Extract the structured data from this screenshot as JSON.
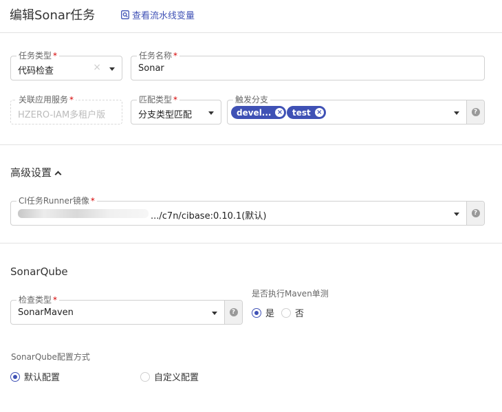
{
  "header": {
    "title": "编辑Sonar任务",
    "pipeline_link": "查看流水线变量"
  },
  "form": {
    "task_type": {
      "label": "任务类型",
      "value": "代码检查"
    },
    "task_name": {
      "label": "任务名称",
      "value": "Sonar"
    },
    "linked_service": {
      "label": "关联应用服务",
      "placeholder": "HZERO-IAM多租户版"
    },
    "match_type": {
      "label": "匹配类型",
      "value": "分支类型匹配"
    },
    "trigger_branch": {
      "label": "触发分支",
      "tags": [
        "devel...",
        "test"
      ]
    }
  },
  "advanced": {
    "title": "高级设置",
    "runner_image": {
      "label": "CI任务Runner镜像",
      "value": ".../c7n/cibase:0.10.1(默认)"
    }
  },
  "sonarqube": {
    "title": "SonarQube",
    "check_type": {
      "label": "检查类型",
      "value": "SonarMaven"
    },
    "maven_test": {
      "label": "是否执行Maven单测",
      "options": [
        "是",
        "否"
      ],
      "selected": "是"
    },
    "config_mode": {
      "label": "SonarQube配置方式",
      "options": [
        "默认配置",
        "自定义配置"
      ],
      "selected": "默认配置"
    }
  },
  "icons": {
    "help": "?",
    "tag_remove": "×",
    "clear": "×"
  },
  "colors": {
    "accent": "#3f51b5",
    "required": "#d50000"
  }
}
